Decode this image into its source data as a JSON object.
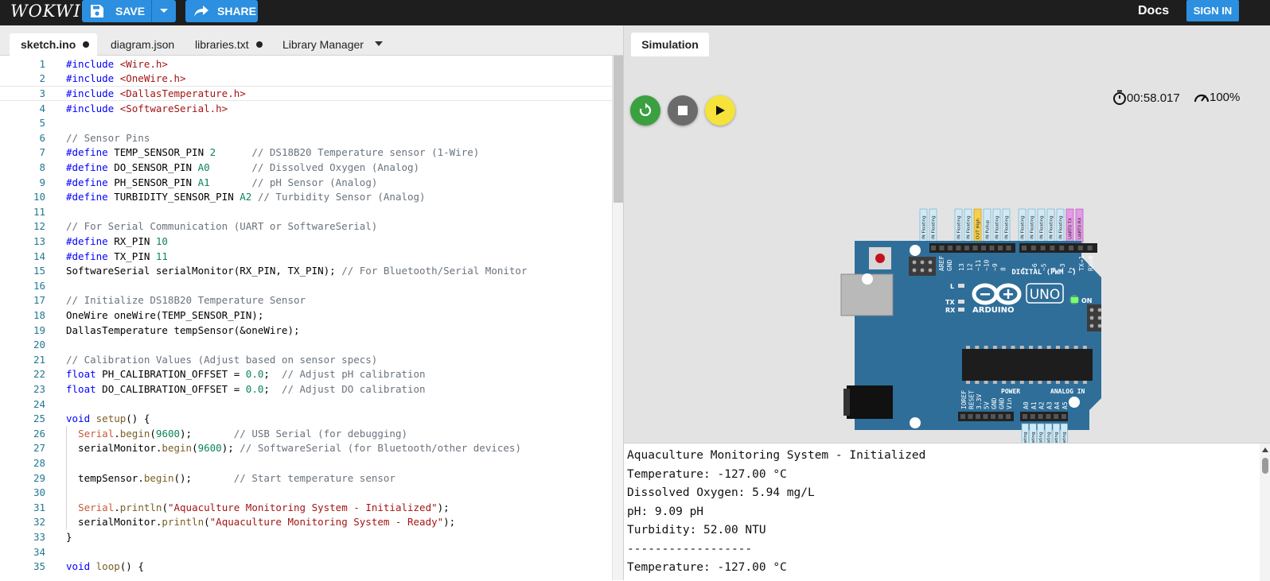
{
  "topbar": {
    "logo": "WOKWI",
    "save_label": "SAVE",
    "share_label": "SHARE",
    "docs_label": "Docs",
    "signin_label": "SIGN IN"
  },
  "tabs": [
    {
      "label": "sketch.ino",
      "modified": true,
      "active": true
    },
    {
      "label": "diagram.json",
      "modified": false,
      "active": false
    },
    {
      "label": "libraries.txt",
      "modified": true,
      "active": false
    },
    {
      "label": "Library Manager",
      "modified": false,
      "active": false
    }
  ],
  "code_lines": [
    "#include <Wire.h>",
    "#include <OneWire.h>",
    "#include <DallasTemperature.h>",
    "#include <SoftwareSerial.h>",
    "",
    "// Sensor Pins",
    "#define TEMP_SENSOR_PIN 2      // DS18B20 Temperature sensor (1-Wire)",
    "#define DO_SENSOR_PIN A0       // Dissolved Oxygen (Analog)",
    "#define PH_SENSOR_PIN A1       // pH Sensor (Analog)",
    "#define TURBIDITY_SENSOR_PIN A2 // Turbidity Sensor (Analog)",
    "",
    "// For Serial Communication (UART or SoftwareSerial)",
    "#define RX_PIN 10",
    "#define TX_PIN 11",
    "SoftwareSerial serialMonitor(RX_PIN, TX_PIN); // For Bluetooth/Serial Monitor",
    "",
    "// Initialize DS18B20 Temperature Sensor",
    "OneWire oneWire(TEMP_SENSOR_PIN);",
    "DallasTemperature tempSensor(&oneWire);",
    "",
    "// Calibration Values (Adjust based on sensor specs)",
    "float PH_CALIBRATION_OFFSET = 0.0;  // Adjust pH calibration",
    "float DO_CALIBRATION_OFFSET = 0.0;  // Adjust DO calibration",
    "",
    "void setup() {",
    "  Serial.begin(9600);       // USB Serial (for debugging)",
    "  serialMonitor.begin(9600); // SoftwareSerial (for Bluetooth/other devices)",
    "",
    "  tempSensor.begin();       // Start temperature sensor",
    "",
    "  Serial.println(\"Aquaculture Monitoring System - Initialized\");",
    "  serialMonitor.println(\"Aquaculture Monitoring System - Ready\");",
    "}",
    "",
    "void loop() {"
  ],
  "simulation": {
    "tab_label": "Simulation",
    "timer": "00:58.017",
    "speed": "100%"
  },
  "board": {
    "brand": "ARDUINO",
    "model": "UNO",
    "on_label": "ON",
    "digital_label": "DIGITAL (PWM ~)",
    "power_label": "POWER",
    "analog_label": "ANALOG IN",
    "l_label": "L",
    "tx_label": "TX",
    "rx_label": "RX",
    "aref": "AREF",
    "gnd": "GND",
    "top_pins": [
      "13",
      "12",
      "~11",
      "~10",
      "~9",
      "8",
      "7",
      "~6",
      "~5",
      "4",
      "~3",
      "2",
      "TX→1",
      "RX←0"
    ],
    "power_pins": [
      "IOREF",
      "RESET",
      "3.3V",
      "5V",
      "GND",
      "GND",
      "Vin"
    ],
    "analog_pins": [
      "A0",
      "A1",
      "A2",
      "A3",
      "A4",
      "A5"
    ],
    "top_tags": [
      "IN Floating",
      "IN Floating",
      "IN Floating",
      "IN Floating",
      "OUT High",
      "IN Pullup",
      "IN Floating",
      "IN Floating",
      "IN Floating",
      "IN Floating",
      "IN Floating",
      "IN Floating",
      "IN Floating",
      "UART0 TX",
      "UART0 RX"
    ],
    "bottom_tags": [
      "IN Floating",
      "IN Floating",
      "IN Floating",
      "IN Floating",
      "IN Floating",
      "IN Floating"
    ]
  },
  "serial_lines": [
    "Aquaculture Monitoring System - Initialized",
    "Temperature: -127.00 °C",
    "Dissolved Oxygen: 5.94 mg/L",
    "pH: 9.09 pH",
    "Turbidity: 52.00 NTU",
    "------------------",
    "Temperature: -127.00 °C"
  ],
  "colors": {
    "topbar": "#1e1e1e",
    "accent": "#2c8fe0",
    "board": "#2f6e99",
    "restart": "#3aa040",
    "stop": "#6b6b6b",
    "play": "#f5e23a"
  }
}
